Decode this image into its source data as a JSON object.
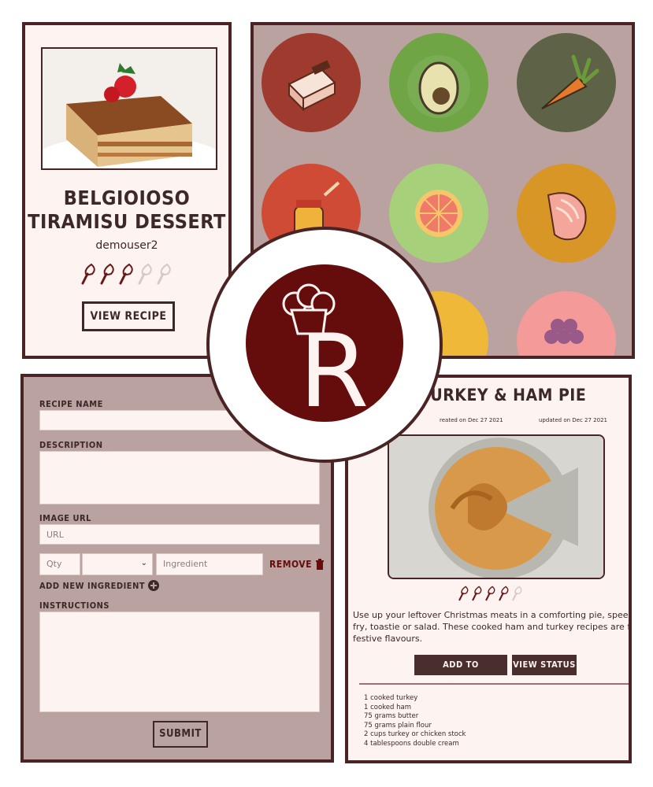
{
  "card": {
    "title_line1": "BELGIOIOSO",
    "title_line2": "TIRAMISU DESSERT",
    "author": "demouser2",
    "rating": 3,
    "rating_max": 5,
    "view_button": "VIEW RECIPE"
  },
  "grid": {
    "icons": [
      "cake-icon",
      "avocado-icon",
      "carrot-icon",
      "jam-jar-icon",
      "grapefruit-icon",
      "salmon-icon",
      "lemon-icon",
      "grapes-icon"
    ],
    "colors": [
      "#9e3a2e",
      "#6fa545",
      "#5e6246",
      "#cf4b35",
      "#a7d07a",
      "#d89626",
      "#f0b838",
      "#f49a98"
    ]
  },
  "form": {
    "recipe_name_label": "RECIPE NAME",
    "description_label": "DESCRIPTION",
    "image_url_label": "IMAGE URL",
    "image_url_placeholder": "URL",
    "qty_placeholder": "Qty",
    "ingredient_placeholder": "Ingredient",
    "remove_label": "REMOVE",
    "add_ingredient_label": "ADD NEW INGREDIENT",
    "instructions_label": "INSTRUCTIONS",
    "submit_label": "SUBMIT"
  },
  "detail": {
    "title": "EL TURKEY & HAM PIE",
    "created": "reated on Dec 27 2021",
    "updated": "updated on Dec 27 2021",
    "rating": 4,
    "rating_max": 5,
    "desc_line1": "Use up your leftover Christmas meats in a comforting pie, speedy st",
    "desc_line2": "fry, toastie or salad. These cooked ham and turkey recipes are full of",
    "desc_line3": "festive flavours.",
    "add_collection": "ADD TO COLLECTION",
    "view_status": "VIEW STATUS",
    "ingredients": [
      "1 cooked turkey",
      "1 cooked ham",
      "75 grams butter",
      "75 grams plain flour",
      "2 cups turkey or chicken stock",
      "4 tablespoons double cream"
    ]
  },
  "logo": {
    "letter": "R"
  }
}
